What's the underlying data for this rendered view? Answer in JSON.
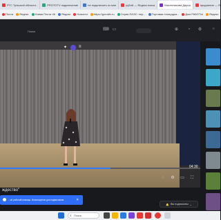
{
  "browser": {
    "tabs": [
      {
        "label": "РТС Тульской области -",
        "color": "#e33"
      },
      {
        "label": "PROTOTV подключение",
        "color": "#2a7"
      },
      {
        "label": "не подключить ко мне",
        "color": "#47c"
      },
      {
        "label": "ру5л6 — Яндекс.поиск",
        "color": "#f33"
      },
      {
        "label": "Масленикова Дарья",
        "color": "#7d2bd6",
        "active": true
      },
      {
        "label": "продление — Яндекс поиск",
        "color": "#f33"
      }
    ],
    "bookmarks": [
      "Почта",
      "Яндекс",
      "Новая Почта 46",
      "Яндекс",
      "Новости",
      "https://gorodtv.ru",
      "Серия ЕАЭС: пер...",
      "Торговая площадка...",
      "Дом РАБОТЫ",
      "Яндекс"
    ]
  },
  "topnav": {
    "search_label": "Поиск"
  },
  "player": {
    "time": "04:30",
    "progress_fraction": 0.55
  },
  "video_title": "ждество\"",
  "notification": {
    "text": "...ой рабочий помощи. Используется для подписчиков."
  },
  "subscribe_button": {
    "label": "Вы подписаны"
  },
  "taskbar": {
    "search_placeholder": "Поиск"
  },
  "sidebar": {
    "thumbs": [
      {
        "label": "",
        "color": "#3a8ccf"
      },
      {
        "label": "",
        "color": "#3ba7c9"
      },
      {
        "label": "",
        "color": "#6a7a4f"
      },
      {
        "label": "",
        "color": "#4d92b6"
      },
      {
        "label": "",
        "color": "#3d6a94"
      },
      {
        "label": "",
        "color": "#7f8a90"
      },
      {
        "label": "",
        "color": "#5c7f3a"
      },
      {
        "label": "",
        "color": "#6e4f86"
      }
    ]
  }
}
